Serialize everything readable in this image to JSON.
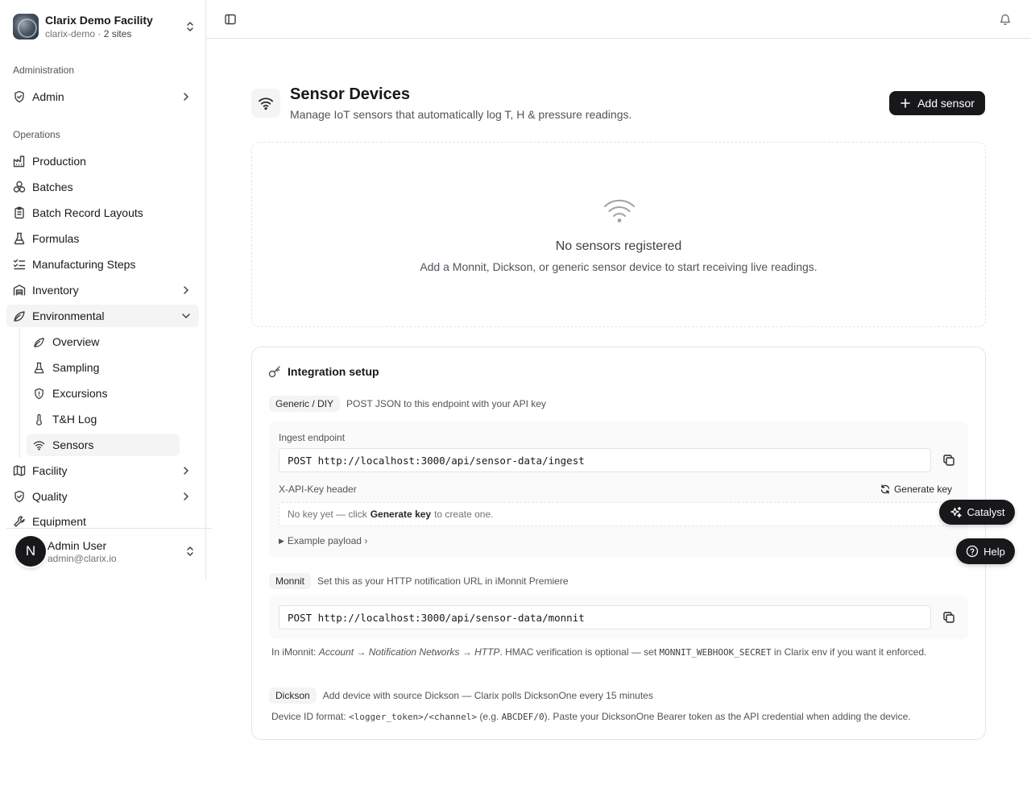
{
  "org": {
    "name": "Clarix Demo Facility",
    "slug": "clarix-demo",
    "sites": "2 sites",
    "separator": " · "
  },
  "sidebar": {
    "admin_section": "Administration",
    "admin_item": "Admin",
    "ops_section": "Operations",
    "items": {
      "production": "Production",
      "batches": "Batches",
      "batch_record_layouts": "Batch Record Layouts",
      "formulas": "Formulas",
      "manufacturing_steps": "Manufacturing Steps",
      "inventory": "Inventory",
      "environmental": "Environmental",
      "facility": "Facility",
      "quality": "Quality",
      "equipment": "Equipment"
    },
    "env_sub": {
      "overview": "Overview",
      "sampling": "Sampling",
      "excursions": "Excursions",
      "th_log": "T&H Log",
      "sensors": "Sensors"
    }
  },
  "user": {
    "initial": "N",
    "name": "Admin User",
    "email": "admin@clarix.io"
  },
  "page": {
    "title": "Sensor Devices",
    "subtitle": "Manage IoT sensors that automatically log T, H & pressure readings.",
    "add_button": "Add sensor"
  },
  "empty": {
    "title": "No sensors registered",
    "subtitle": "Add a Monnit, Dickson, or generic sensor device to start receiving live readings."
  },
  "integration": {
    "title": "Integration setup",
    "generic": {
      "badge": "Generic / DIY",
      "desc": "POST JSON to this endpoint with your API key",
      "endpoint_label": "Ingest endpoint",
      "endpoint": "POST http://localhost:3000/api/sensor-data/ingest",
      "key_label": "X-API-Key header",
      "generate": "Generate key",
      "key_pre": "No key yet — click",
      "key_bold": "Generate key",
      "key_post": "to create one.",
      "example": "Example payload ›"
    },
    "monnit": {
      "badge": "Monnit",
      "desc": "Set this as your HTTP notification URL in iMonnit Premiere",
      "endpoint": "POST http://localhost:3000/api/sensor-data/monnit",
      "note_1": "In iMonnit: ",
      "note_path": "Account → Notification Networks → HTTP",
      "note_2": ". HMAC verification is optional — set ",
      "note_code": "MONNIT_WEBHOOK_SECRET",
      "note_3": " in Clarix env if you want it enforced."
    },
    "dickson": {
      "badge": "Dickson",
      "desc": "Add device with source Dickson — Clarix polls DicksonOne every 15 minutes",
      "note_1": "Device ID format: ",
      "note_code1": "<logger_token>/<channel>",
      "note_2": " (e.g. ",
      "note_code2": "ABCDEF/0",
      "note_3": "). Paste your DicksonOne Bearer token as the API credential when adding the device."
    }
  },
  "floating": {
    "catalyst": "Catalyst",
    "help": "Help"
  }
}
